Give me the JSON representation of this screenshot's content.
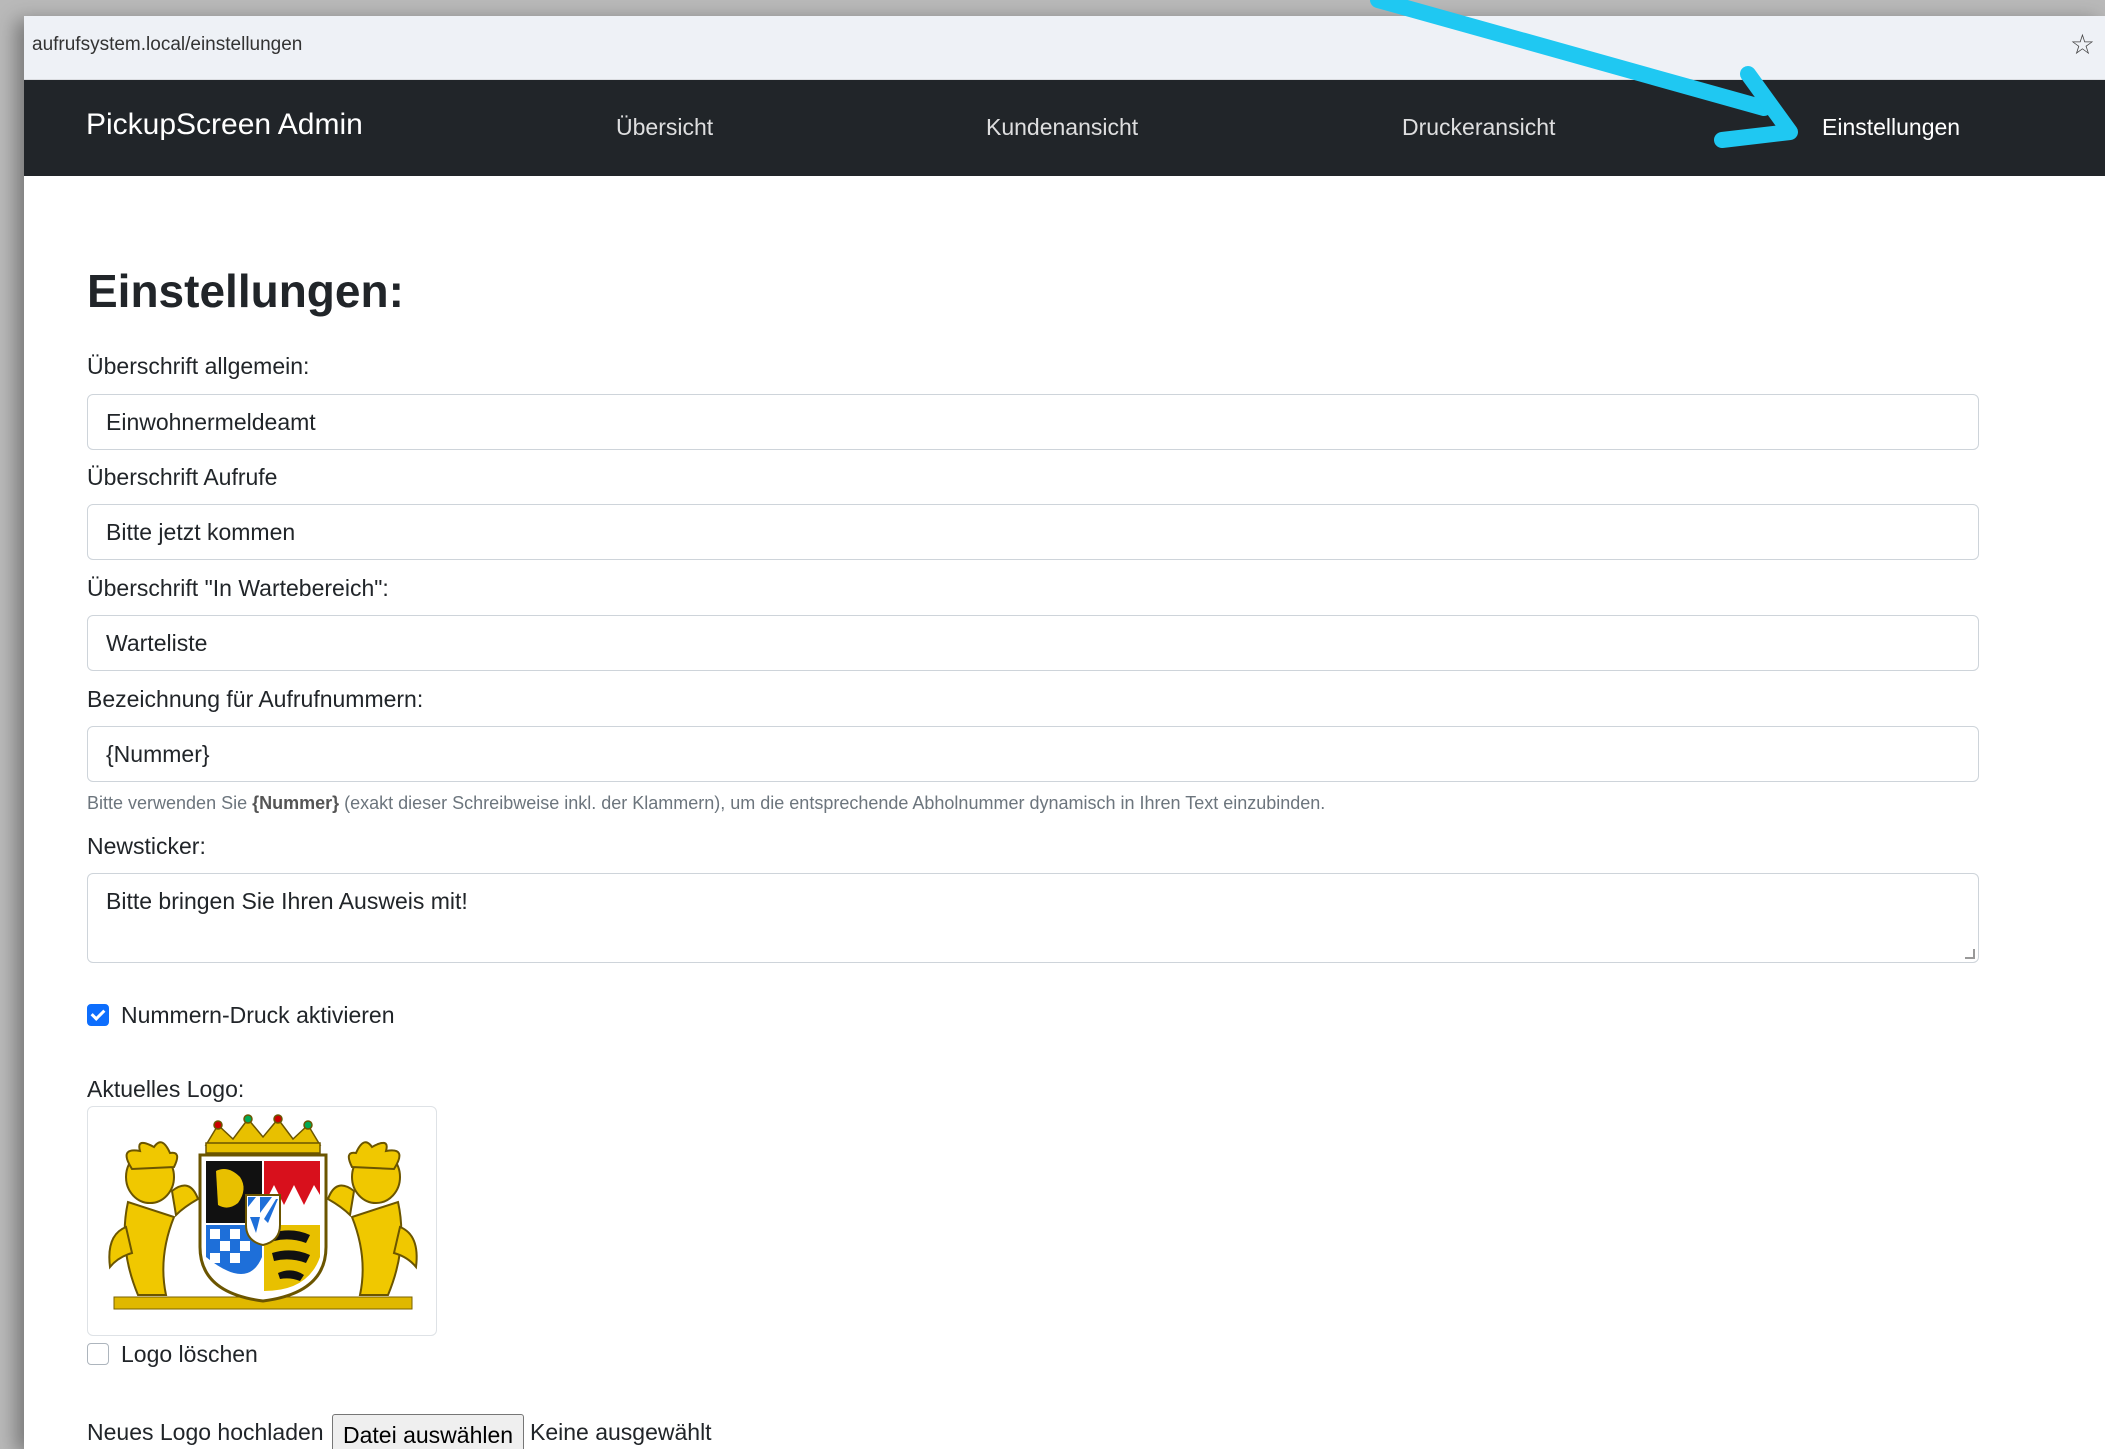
{
  "browser": {
    "url": "aufrufsystem.local/einstellungen"
  },
  "navbar": {
    "brand": "PickupScreen Admin",
    "links": [
      "Übersicht",
      "Kundenansicht",
      "Druckeransicht",
      "Einstellungen"
    ]
  },
  "page": {
    "title": "Einstellungen:"
  },
  "form": {
    "heading_general_label": "Überschrift allgemein:",
    "heading_general_value": "Einwohnermeldeamt",
    "heading_calls_label": "Überschrift Aufrufe",
    "heading_calls_value": "Bitte jetzt kommen",
    "heading_waiting_label": "Überschrift \"In Wartebereich\":",
    "heading_waiting_value": "Warteliste",
    "number_label": "Bezeichnung für Aufrufnummern:",
    "number_value": "{Nummer}",
    "hint_prefix": "Bitte verwenden Sie ",
    "hint_token": "{Nummer}",
    "hint_suffix": " (exakt dieser Schreibweise inkl. der Klammern), um die entsprechende Abholnummer dynamisch in Ihren Text einzubinden.",
    "newsticker_label": "Newsticker:",
    "newsticker_value": "Bitte bringen Sie Ihren Ausweis mit!",
    "print_checkbox_label": "Nummern-Druck aktivieren",
    "print_checkbox_checked": true,
    "current_logo_label": "Aktuelles Logo:",
    "delete_logo_label": "Logo löschen",
    "delete_logo_checked": false,
    "upload_label": "Neues Logo hochladen",
    "upload_button": "Datei auswählen",
    "upload_status": "Keine ausgewählt"
  },
  "colors": {
    "navbar_bg": "#212529",
    "checkbox_accent": "#0d6efd",
    "annotation_arrow": "#1fc8f2"
  }
}
